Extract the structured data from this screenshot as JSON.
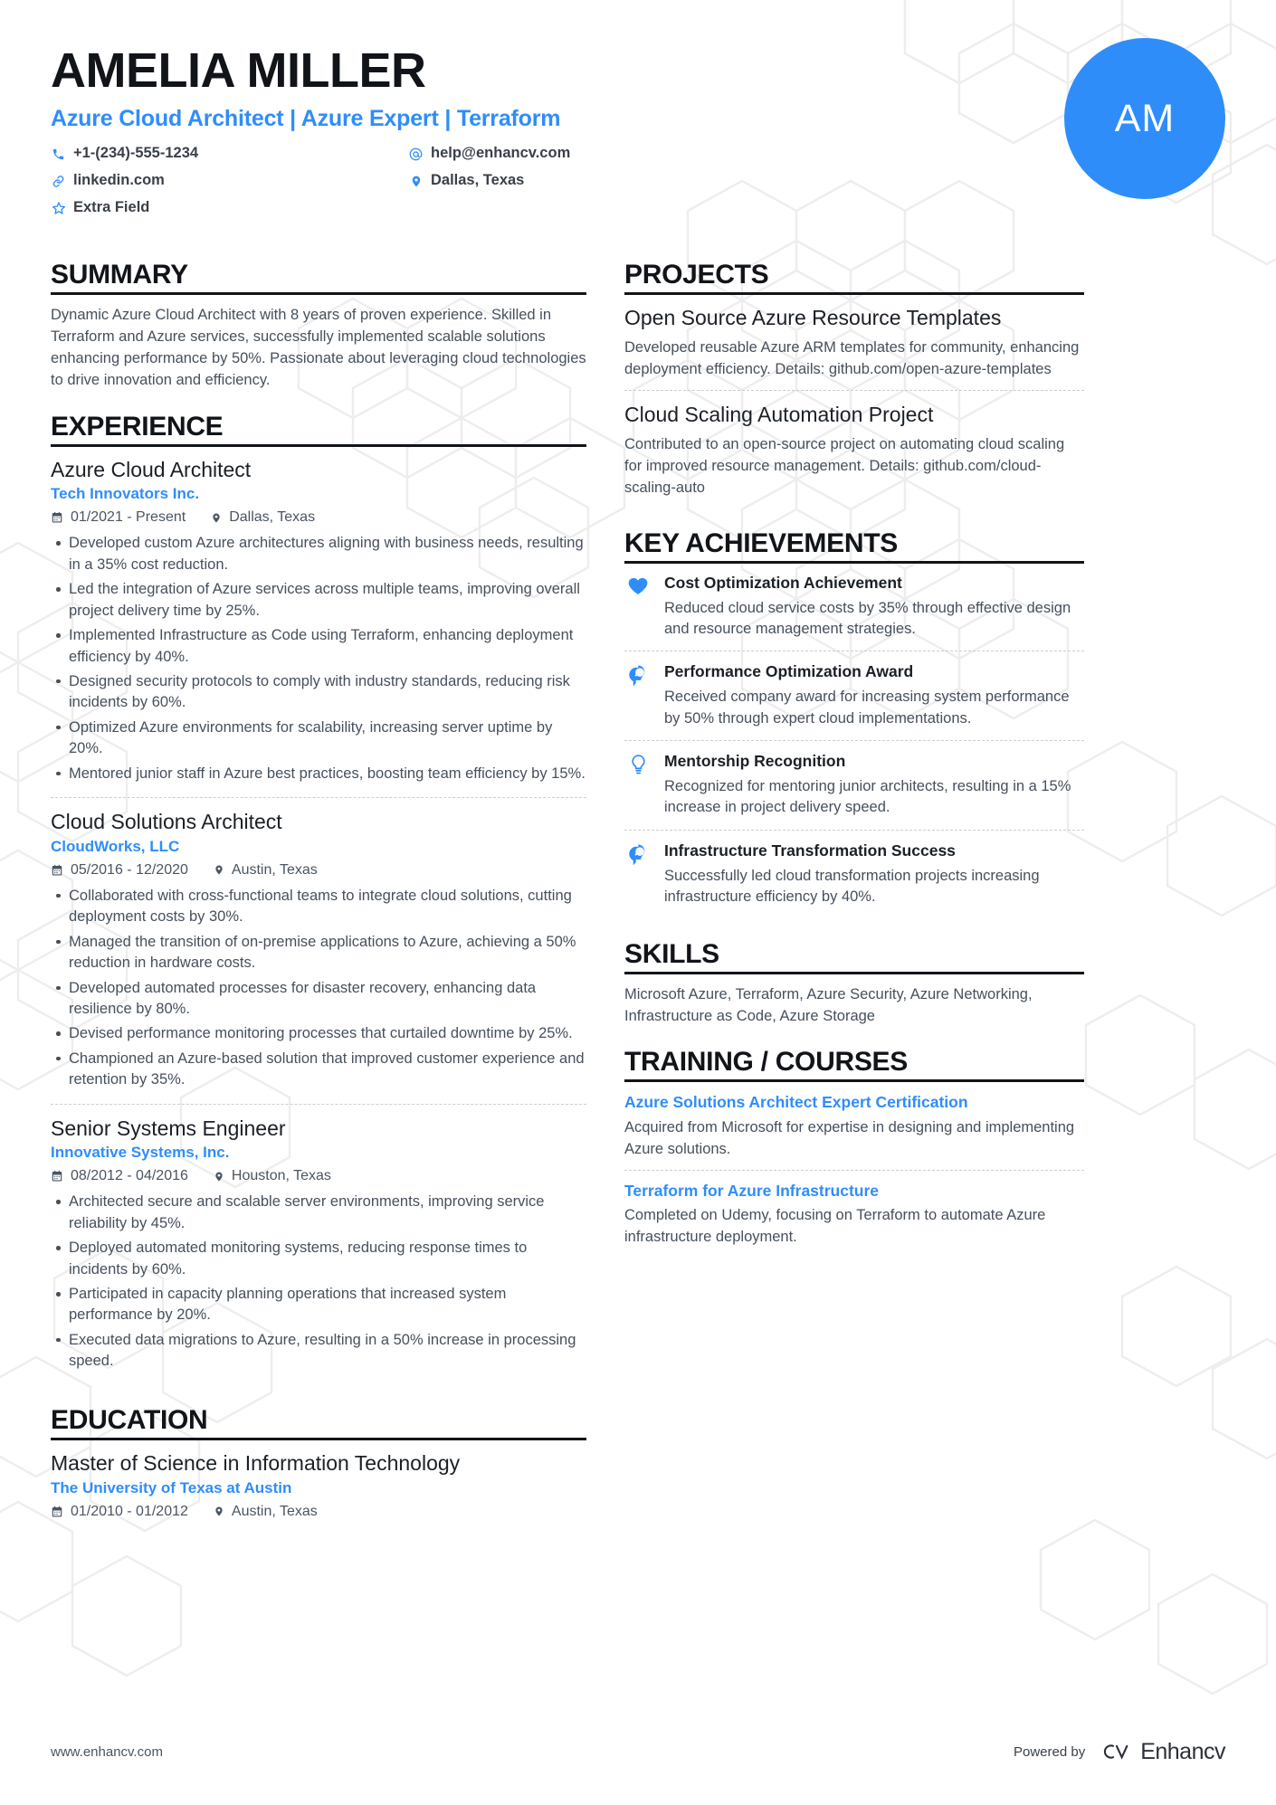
{
  "header": {
    "name": "AMELIA MILLER",
    "subtitle": "Azure Cloud Architect | Azure Expert | Terraform",
    "avatar_initials": "AM",
    "accent_color": "#2f8dfa",
    "contacts": [
      {
        "icon": "phone-icon",
        "value": "+1-(234)-555-1234"
      },
      {
        "icon": "at-icon",
        "value": "help@enhancv.com"
      },
      {
        "icon": "link-icon",
        "value": "linkedin.com"
      },
      {
        "icon": "location-icon",
        "value": "Dallas, Texas"
      },
      {
        "icon": "star-icon",
        "value": "Extra Field"
      }
    ]
  },
  "summary": {
    "heading": "SUMMARY",
    "text": "Dynamic Azure Cloud Architect with 8 years of proven experience. Skilled in Terraform and Azure services, successfully implemented scalable solutions enhancing performance by 50%. Passionate about leveraging cloud technologies to drive innovation and efficiency."
  },
  "experience": {
    "heading": "EXPERIENCE",
    "entries": [
      {
        "title": "Azure Cloud Architect",
        "org": "Tech Innovators Inc.",
        "dates": "01/2021 - Present",
        "location": "Dallas, Texas",
        "bullets": [
          "Developed custom Azure architectures aligning with business needs, resulting in a 35% cost reduction.",
          "Led the integration of Azure services across multiple teams, improving overall project delivery time by 25%.",
          "Implemented Infrastructure as Code using Terraform, enhancing deployment efficiency by 40%.",
          "Designed security protocols to comply with industry standards, reducing risk incidents by 60%.",
          "Optimized Azure environments for scalability, increasing server uptime by 20%.",
          "Mentored junior staff in Azure best practices, boosting team efficiency by 15%."
        ]
      },
      {
        "title": "Cloud Solutions Architect",
        "org": "CloudWorks, LLC",
        "dates": "05/2016 - 12/2020",
        "location": "Austin, Texas",
        "bullets": [
          "Collaborated with cross-functional teams to integrate cloud solutions, cutting deployment costs by 30%.",
          "Managed the transition of on-premise applications to Azure, achieving a 50% reduction in hardware costs.",
          "Developed automated processes for disaster recovery, enhancing data resilience by 80%.",
          "Devised performance monitoring processes that curtailed downtime by 25%.",
          "Championed an Azure-based solution that improved customer experience and retention by 35%."
        ]
      },
      {
        "title": "Senior Systems Engineer",
        "org": "Innovative Systems, Inc.",
        "dates": "08/2012 - 04/2016",
        "location": "Houston, Texas",
        "bullets": [
          "Architected secure and scalable server environments, improving service reliability by 45%.",
          "Deployed automated monitoring systems, reducing response times to incidents by 60%.",
          "Participated in capacity planning operations that increased system performance by 20%.",
          "Executed data migrations to Azure, resulting in a 50% increase in processing speed."
        ]
      }
    ]
  },
  "education": {
    "heading": "EDUCATION",
    "entries": [
      {
        "title": "Master of Science in Information Technology",
        "org": "The University of Texas at Austin",
        "dates": "01/2010 - 01/2012",
        "location": "Austin, Texas"
      }
    ]
  },
  "projects": {
    "heading": "PROJECTS",
    "entries": [
      {
        "title": "Open Source Azure Resource Templates",
        "desc": "Developed reusable Azure ARM templates for community, enhancing deployment efficiency. Details: github.com/open-azure-templates"
      },
      {
        "title": "Cloud Scaling Automation Project",
        "desc": "Contributed to an open-source project on automating cloud scaling for improved resource management. Details: github.com/cloud-scaling-auto"
      }
    ]
  },
  "achievements": {
    "heading": "KEY ACHIEVEMENTS",
    "entries": [
      {
        "icon": "heart-icon",
        "title": "Cost Optimization Achievement",
        "desc": "Reduced cloud service costs by 35% through effective design and resource management strategies."
      },
      {
        "icon": "head-idea-icon",
        "title": "Performance Optimization Award",
        "desc": "Received company award for increasing system performance by 50% through expert cloud implementations."
      },
      {
        "icon": "lightbulb-icon",
        "title": "Mentorship Recognition",
        "desc": "Recognized for mentoring junior architects, resulting in a 15% increase in project delivery speed."
      },
      {
        "icon": "head-idea-icon",
        "title": "Infrastructure Transformation Success",
        "desc": "Successfully led cloud transformation projects increasing infrastructure efficiency by 40%."
      }
    ]
  },
  "skills": {
    "heading": "SKILLS",
    "text": "Microsoft Azure, Terraform, Azure Security, Azure Networking, Infrastructure as Code, Azure Storage"
  },
  "training": {
    "heading": "TRAINING / COURSES",
    "entries": [
      {
        "title": "Azure Solutions Architect Expert Certification",
        "desc": "Acquired from Microsoft for expertise in designing and implementing Azure solutions."
      },
      {
        "title": "Terraform for Azure Infrastructure",
        "desc": "Completed on Udemy, focusing on Terraform to automate Azure infrastructure deployment."
      }
    ]
  },
  "footer": {
    "url": "www.enhancv.com",
    "powered_by": "Powered by",
    "brand": "Enhancv"
  }
}
